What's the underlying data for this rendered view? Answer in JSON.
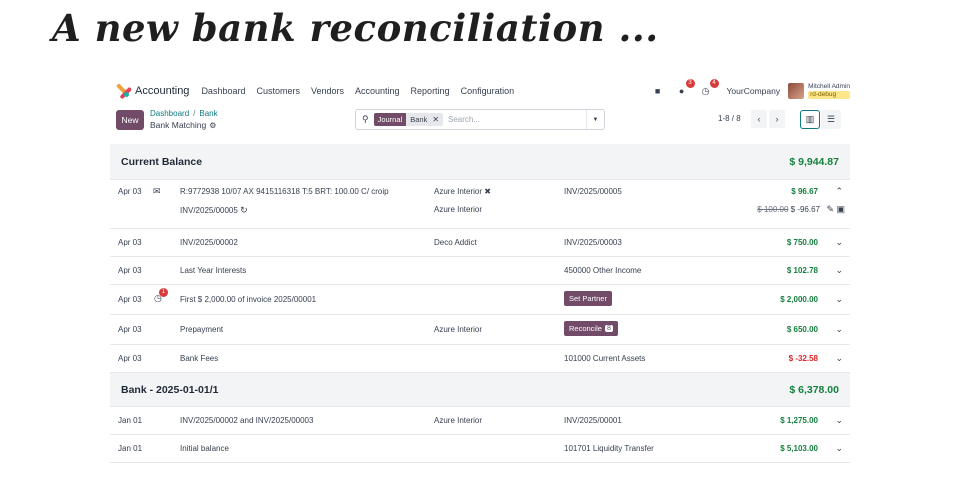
{
  "headline": "A new bank reconciliation ...",
  "navbar": {
    "app_name": "Accounting",
    "menu": [
      "Dashboard",
      "Customers",
      "Vendors",
      "Accounting",
      "Reporting",
      "Configuration"
    ],
    "chat_badge": "3",
    "activity_badge": "4",
    "company": "YourCompany",
    "user": "Mitchell Admin",
    "database": "rd-debug"
  },
  "control": {
    "new_label": "New",
    "breadcrumb": [
      "Dashboard",
      "Bank"
    ],
    "breadcrumb_sep": "/",
    "title": "Bank Matching",
    "facet_label": "Journal",
    "facet_value": "Bank",
    "search_placeholder": "Search...",
    "pager": "1-8 / 8"
  },
  "groups": [
    {
      "title": "Current Balance",
      "amount": "$ 9,944.87",
      "rows": [
        {
          "date": "Apr 03",
          "label": "R:9772938 10/07 AX 9415116318 T:5 BRT: 100.00 C/ croip",
          "label2": "INV/2025/00005",
          "partner": "Azure Interior",
          "partner2": "Azure Interior",
          "doc": "INV/2025/00005",
          "amount": "$ 96.67",
          "amount_old": "$ 100.00",
          "amount_new": "$ -96.67"
        },
        {
          "date": "Apr 03",
          "label": "INV/2025/00002",
          "partner": "Deco Addict",
          "doc": "INV/2025/00003",
          "amount": "$ 750.00"
        },
        {
          "date": "Apr 03",
          "label": "Last Year Interests",
          "partner": "",
          "doc": "450000 Other Income",
          "amount": "$ 102.78"
        },
        {
          "date": "Apr 03",
          "label": "First $ 2,000.00 of invoice 2025/00001",
          "activity_badge": "1",
          "partner": "",
          "doc_button": "Set Partner",
          "amount": "$ 2,000.00"
        },
        {
          "date": "Apr 03",
          "label": "Prepayment",
          "partner": "Azure Interior",
          "doc_button": "Reconcile",
          "doc_count": "8",
          "amount": "$ 650.00"
        },
        {
          "date": "Apr 03",
          "label": "Bank Fees",
          "partner": "",
          "doc": "101000 Current Assets",
          "amount": "$ -32.58"
        }
      ]
    },
    {
      "title": "Bank - 2025-01-01/1",
      "amount": "$ 6,378.00",
      "rows": [
        {
          "date": "Jan 01",
          "label": "INV/2025/00002 and INV/2025/00003",
          "partner": "Azure Interior",
          "doc": "INV/2025/00001",
          "amount": "$ 1,275.00"
        },
        {
          "date": "Jan 01",
          "label": "Initial balance",
          "partner": "",
          "doc": "101701 Liquidity Transfer",
          "amount": "$ 5,103.00"
        }
      ]
    }
  ]
}
